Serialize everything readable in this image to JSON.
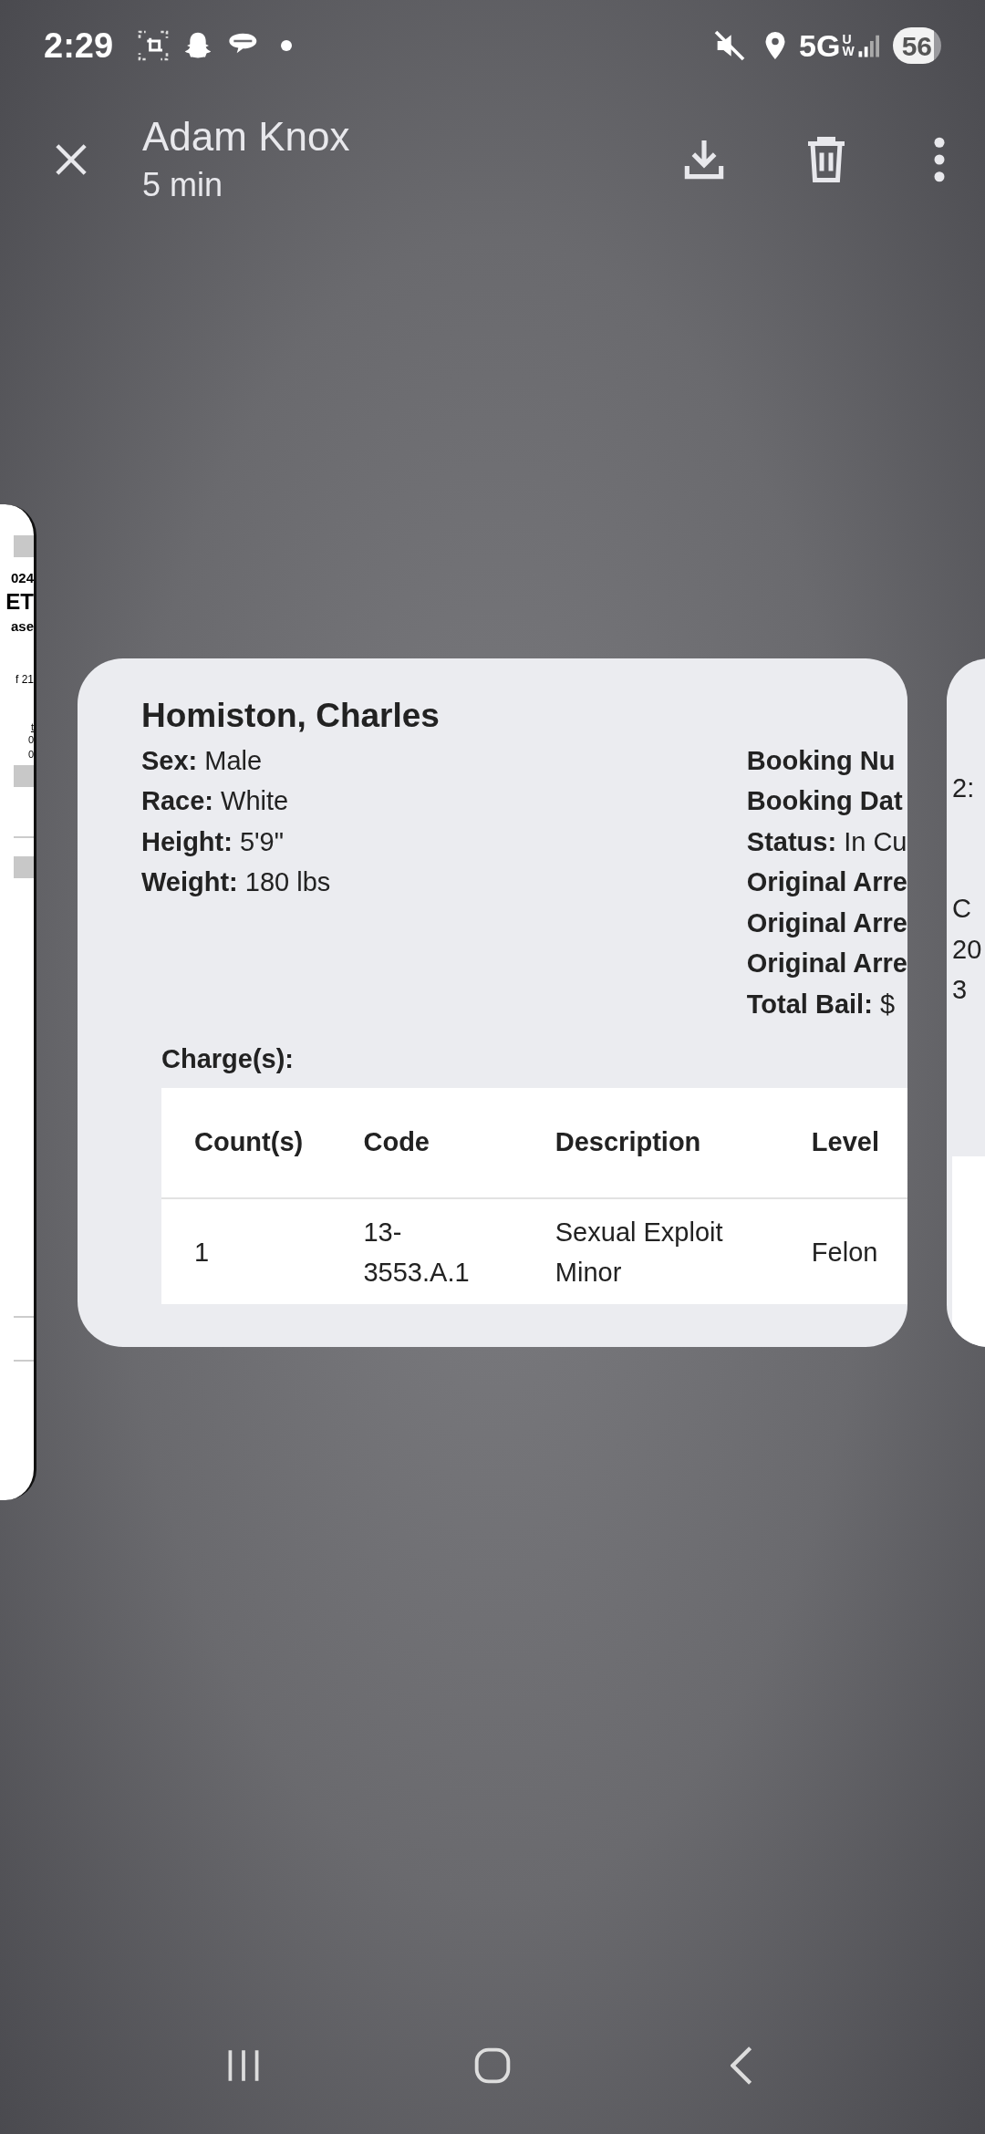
{
  "status_bar": {
    "time": "2:29",
    "network": "5G",
    "network_sub_top": "U",
    "network_sub_bottom": "W",
    "battery": "56"
  },
  "header": {
    "title": "Adam Knox",
    "subtitle": "5 min"
  },
  "left_card": {
    "texts": [
      "024",
      "ET",
      "ase",
      "f 21",
      "t",
      "0",
      "0"
    ]
  },
  "record": {
    "name": "Homiston, Charles",
    "left_fields": [
      "**Sex:** Male",
      "**Race:** White",
      "**Height:** 5'9\"",
      "**Weight:** 180 lbs"
    ],
    "right_fields": [
      "**Booking Nu**",
      "**Booking Dat**",
      "**Status:** In Cu",
      "**Original Arre**",
      "**Original Arre**",
      "**Original Arre**",
      "**Total Bail:** $"
    ],
    "charges_label": "Charge(s):",
    "table": {
      "columns": [
        "Count(s)",
        "Code",
        "Description",
        "Level"
      ],
      "rows": [
        [
          "1",
          "13-\n3553.A.1",
          "Sexual Exploit\nMinor",
          "Felon"
        ]
      ]
    }
  },
  "right_card": {
    "texts": [
      "2:",
      "C",
      "20",
      "3"
    ]
  }
}
